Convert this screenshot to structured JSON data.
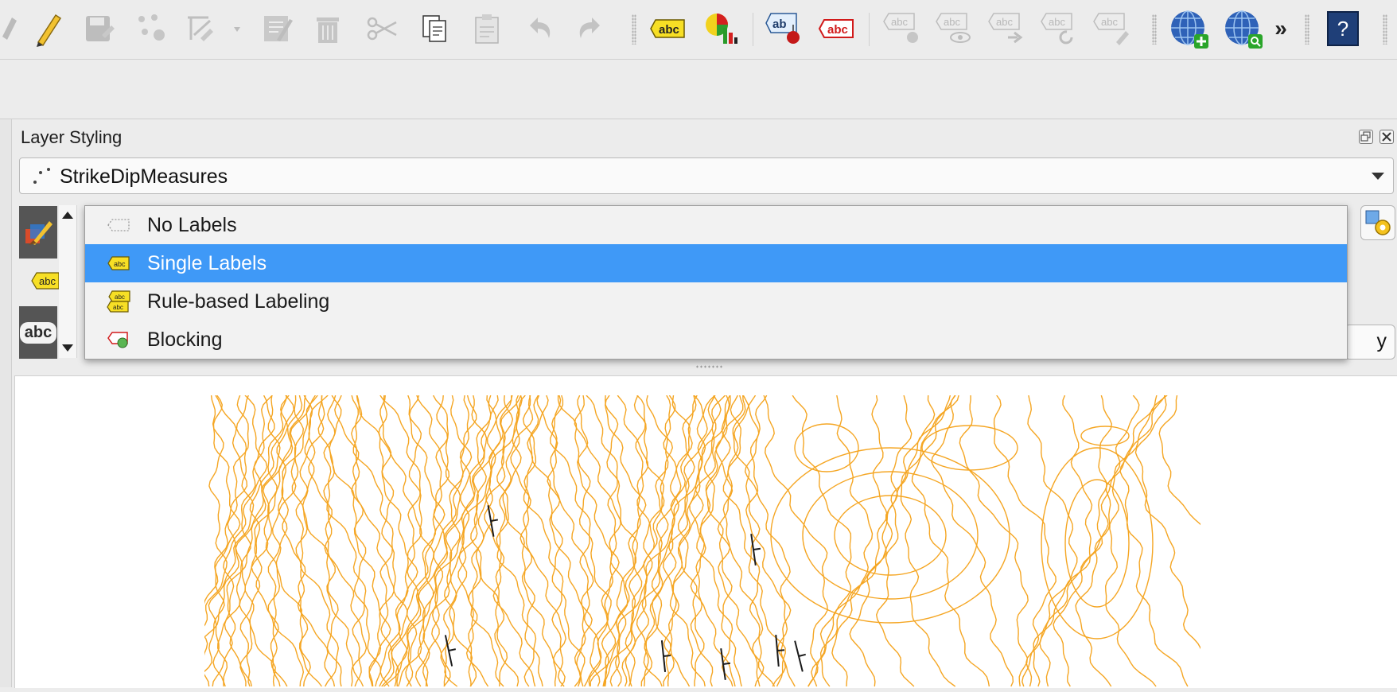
{
  "panel": {
    "title": "Layer Styling",
    "layer_name": "StrikeDipMeasures"
  },
  "label_modes": [
    {
      "label": "No Labels",
      "icon": "no-labels-icon",
      "selected": false
    },
    {
      "label": "Single Labels",
      "icon": "single-labels-icon",
      "selected": true
    },
    {
      "label": "Rule-based Labeling",
      "icon": "rule-based-labeling-icon",
      "selected": false
    },
    {
      "label": "Blocking",
      "icon": "blocking-icon",
      "selected": false
    }
  ],
  "side_tabs": {
    "labels_abc": "abc",
    "text_abc": "abc"
  },
  "apply_fragment": "y",
  "toolbar": {
    "help_glyph": "?",
    "overflow_glyph": "»",
    "label_tool_text": "abc",
    "pin_text": "ab"
  },
  "colors": {
    "selection": "#3f99f7",
    "contour": "#f5a623",
    "strike_dip": "#1a1a1a"
  }
}
